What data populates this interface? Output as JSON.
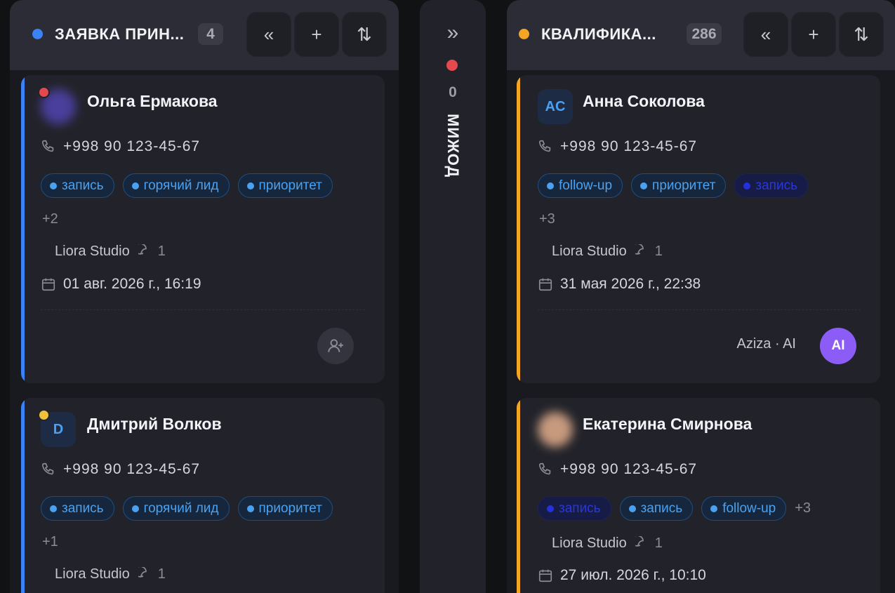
{
  "colors": {
    "blue": "#3b82f6",
    "orange": "#f5a524",
    "red": "#e5484d",
    "yellow": "#f0c23a",
    "tag_text": "#4ba1ef",
    "ai": "#8b5cf6"
  },
  "columns": [
    {
      "title": "ЗАЯВКА ПРИН...",
      "count": "4",
      "status_color": "blue",
      "buttons": [
        "«",
        "+",
        "⇅"
      ],
      "cards": [
        {
          "name": "Ольга Ермакова",
          "avatar": "blurred-photo",
          "presence": "red",
          "phone": "+998 90 123-45-67",
          "tags": [
            "запись",
            "горячий лид",
            "приоритет"
          ],
          "more": "+2",
          "company": "Liora Studio",
          "comments": "1",
          "date": "01 авг. 2026 г., 16:19",
          "assign_icon": "add-user-icon"
        },
        {
          "name": "Дмитрий Волков",
          "avatar_initials": "D",
          "presence": "yellow",
          "phone": "+998 90 123-45-67",
          "tags": [
            "запись",
            "горячий лид",
            "приоритет"
          ],
          "more": "+1",
          "company": "Liora Studio",
          "comments": "1"
        }
      ]
    },
    {
      "title": "МИЖОД",
      "count": "0",
      "collapsed": true,
      "expand_icon": "»",
      "status_color": "red"
    },
    {
      "title": "КВАЛИФИКА...",
      "count": "286",
      "status_color": "orange",
      "buttons": [
        "«",
        "+",
        "⇅"
      ],
      "cards": [
        {
          "name": "Анна Соколова",
          "avatar_initials": "AC",
          "phone": "+998 90 123-45-67",
          "tags": [
            "follow-up",
            "приоритет",
            "запись"
          ],
          "more": "+3",
          "company": "Liora Studio",
          "comments": "1",
          "date": "31 мая 2026 г., 22:38",
          "assignee": "Aziza · AI",
          "assignee_avatar": "AI"
        },
        {
          "name": "Екатерина Смирнова",
          "avatar": "blurred-photo",
          "phone": "+998 90 123-45-67",
          "tags": [
            "запись",
            "запись",
            "follow-up"
          ],
          "more": "+3",
          "company": "Liora Studio",
          "comments": "1",
          "date": "27 июл. 2026 г., 10:10"
        }
      ]
    }
  ]
}
